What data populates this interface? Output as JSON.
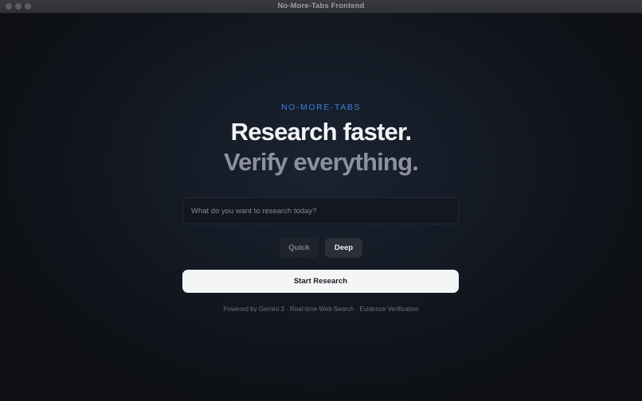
{
  "window": {
    "title": "No-More-Tabs Frontend"
  },
  "hero": {
    "brand": "NO-MORE-TABS",
    "headline_line1": "Research faster.",
    "headline_line2": "Verify everything."
  },
  "search": {
    "value": "",
    "placeholder": "What do you want to research today?"
  },
  "modes": {
    "quick_label": "Quick",
    "deep_label": "Deep",
    "selected": "Deep"
  },
  "actions": {
    "start_label": "Start Research"
  },
  "footer": {
    "text": "Powered by Gemini 3 · Real-time Web Search · Evidence Verification"
  },
  "colors": {
    "accent": "#3f7fe0",
    "background": "#0e1117",
    "primary_button": "#f4f5f7"
  }
}
